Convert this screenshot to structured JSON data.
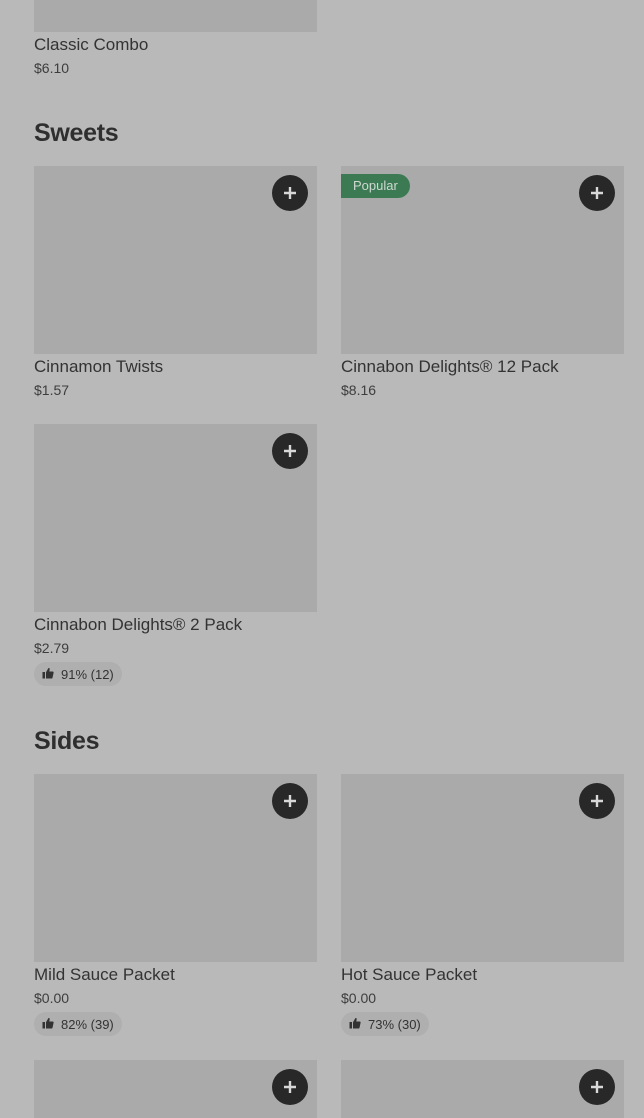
{
  "top_item": {
    "name": "Classic Combo",
    "price": "$6.10"
  },
  "sections": [
    {
      "title": "Sweets",
      "items": [
        {
          "name": "Cinnamon Twists",
          "price": "$1.57",
          "add_icon": "plus-icon"
        },
        {
          "name": "Cinnabon Delights® 12 Pack",
          "price": "$8.16",
          "badge": "Popular",
          "add_icon": "plus-icon"
        },
        {
          "name": "Cinnabon Delights® 2 Pack",
          "price": "$2.79",
          "rating": "91% (12)",
          "add_icon": "plus-icon"
        }
      ]
    },
    {
      "title": "Sides",
      "items": [
        {
          "name": "Mild Sauce Packet",
          "price": "$0.00",
          "rating": "82% (39)",
          "add_icon": "plus-icon"
        },
        {
          "name": "Hot Sauce Packet",
          "price": "$0.00",
          "rating": "73% (30)",
          "add_icon": "plus-icon"
        }
      ]
    }
  ],
  "colors": {
    "overlay_background": "#b9b9b9",
    "image_placeholder": "#aaaaaa",
    "add_button": "#282828",
    "popular_badge": "#3b7a53",
    "rating_pill": "#afafaf"
  },
  "icons": {
    "add": "plus-icon",
    "rating": "thumbs-up-icon"
  }
}
